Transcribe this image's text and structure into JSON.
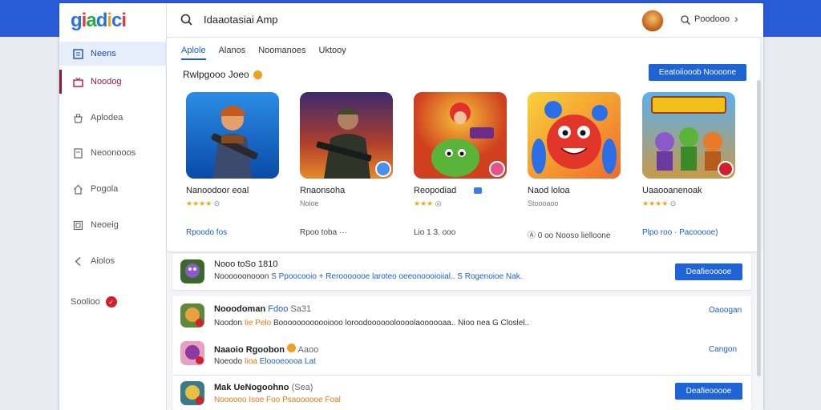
{
  "app": {
    "logo_text": "giadici",
    "search_text": "Idaaotasiai Amp"
  },
  "header": {
    "link_label": "Poodooo",
    "chevron": "›"
  },
  "sidebar": {
    "items": [
      {
        "label": "Neens",
        "icon": "grid-icon"
      },
      {
        "label": "Noodog",
        "icon": "gift-icon"
      },
      {
        "label": "Aplodea",
        "icon": "bag-icon"
      },
      {
        "label": "Neoonooos",
        "icon": "note-icon"
      },
      {
        "label": "Pogola",
        "icon": "home-icon"
      },
      {
        "label": "Neoeig",
        "icon": "frame-icon"
      },
      {
        "label": "Aiolos",
        "icon": "chevron-left-icon"
      }
    ],
    "footer_label": "Soolioo",
    "footer_badge": "✓"
  },
  "tabs": [
    "Aplole",
    "Alanos",
    "Noomanoes",
    "Uktooy"
  ],
  "section": {
    "title": "Rwlpgooo Joeo",
    "button_label": "Eeatoiiooob Noooone"
  },
  "cards": [
    {
      "name": "Nanoodoor eoal",
      "meta_stars": "★★★★",
      "meta_text": "⊙",
      "foot": "Rpoodo  fos"
    },
    {
      "name": "Rnaonsoha",
      "meta_stars": "",
      "meta_text": "Noioe",
      "foot": "Rpoo  toba  ···"
    },
    {
      "name": "Reopodiad",
      "meta_stars": "★★★",
      "meta_text": "◎",
      "foot": "Lio  1 3.  ooo"
    },
    {
      "name": "Naod loloa",
      "meta_stars": "",
      "meta_text": "Stoooaoo",
      "foot": "Ⓐ  0 oo  Nooso  lielloone"
    },
    {
      "name": "Uaaooanenoak",
      "meta_stars": "★★★★",
      "meta_text": "⊙",
      "foot": "Plpo  roo  ·  Pacooooe)"
    }
  ],
  "list_top": {
    "title": "Nooo  toSo 1810",
    "sub_prefix": "Noooooonooon",
    "sub_blue": "S  Ppoocooio +  Rerooooooe  laroteo oeeonoooioiial..  S  Rogenoioe Nak.",
    "button_label": "Deafieooooe"
  },
  "list_rows": [
    {
      "title": "Nooodoman",
      "title_blue": "Fdoo",
      "title_tail": "Sa31",
      "sub_prefix": "Noodon",
      "sub_orange": "Iie  Pelo",
      "sub_rest": "Boooooooooooiooo  loroodooooooloooolaoooooaa..  Nioo  nea  G Closlel..",
      "link_label": "Oaoogan"
    },
    {
      "title": "Naaoio Rgoobon",
      "title_blue": "",
      "title_tail": "Aaoo",
      "sub_prefix": "Noeodo",
      "sub_orange": "Iioa",
      "sub_rest": "Eloooeoooa  Lat",
      "link_label": "Cangon"
    },
    {
      "title": "Mak  UeNogoohno",
      "title_blue": "",
      "title_tail": "(Sea)",
      "sub_prefix": "Noooooo",
      "sub_orange": "Isoe  Foo  Psaoooooe  Foal",
      "sub_rest": "",
      "button_label": "Deafieooooe"
    }
  ],
  "colors": {
    "accent": "#1e64d6",
    "top_band": "#2a5bd6",
    "star": "#f2a614",
    "alert": "#d2202e"
  }
}
